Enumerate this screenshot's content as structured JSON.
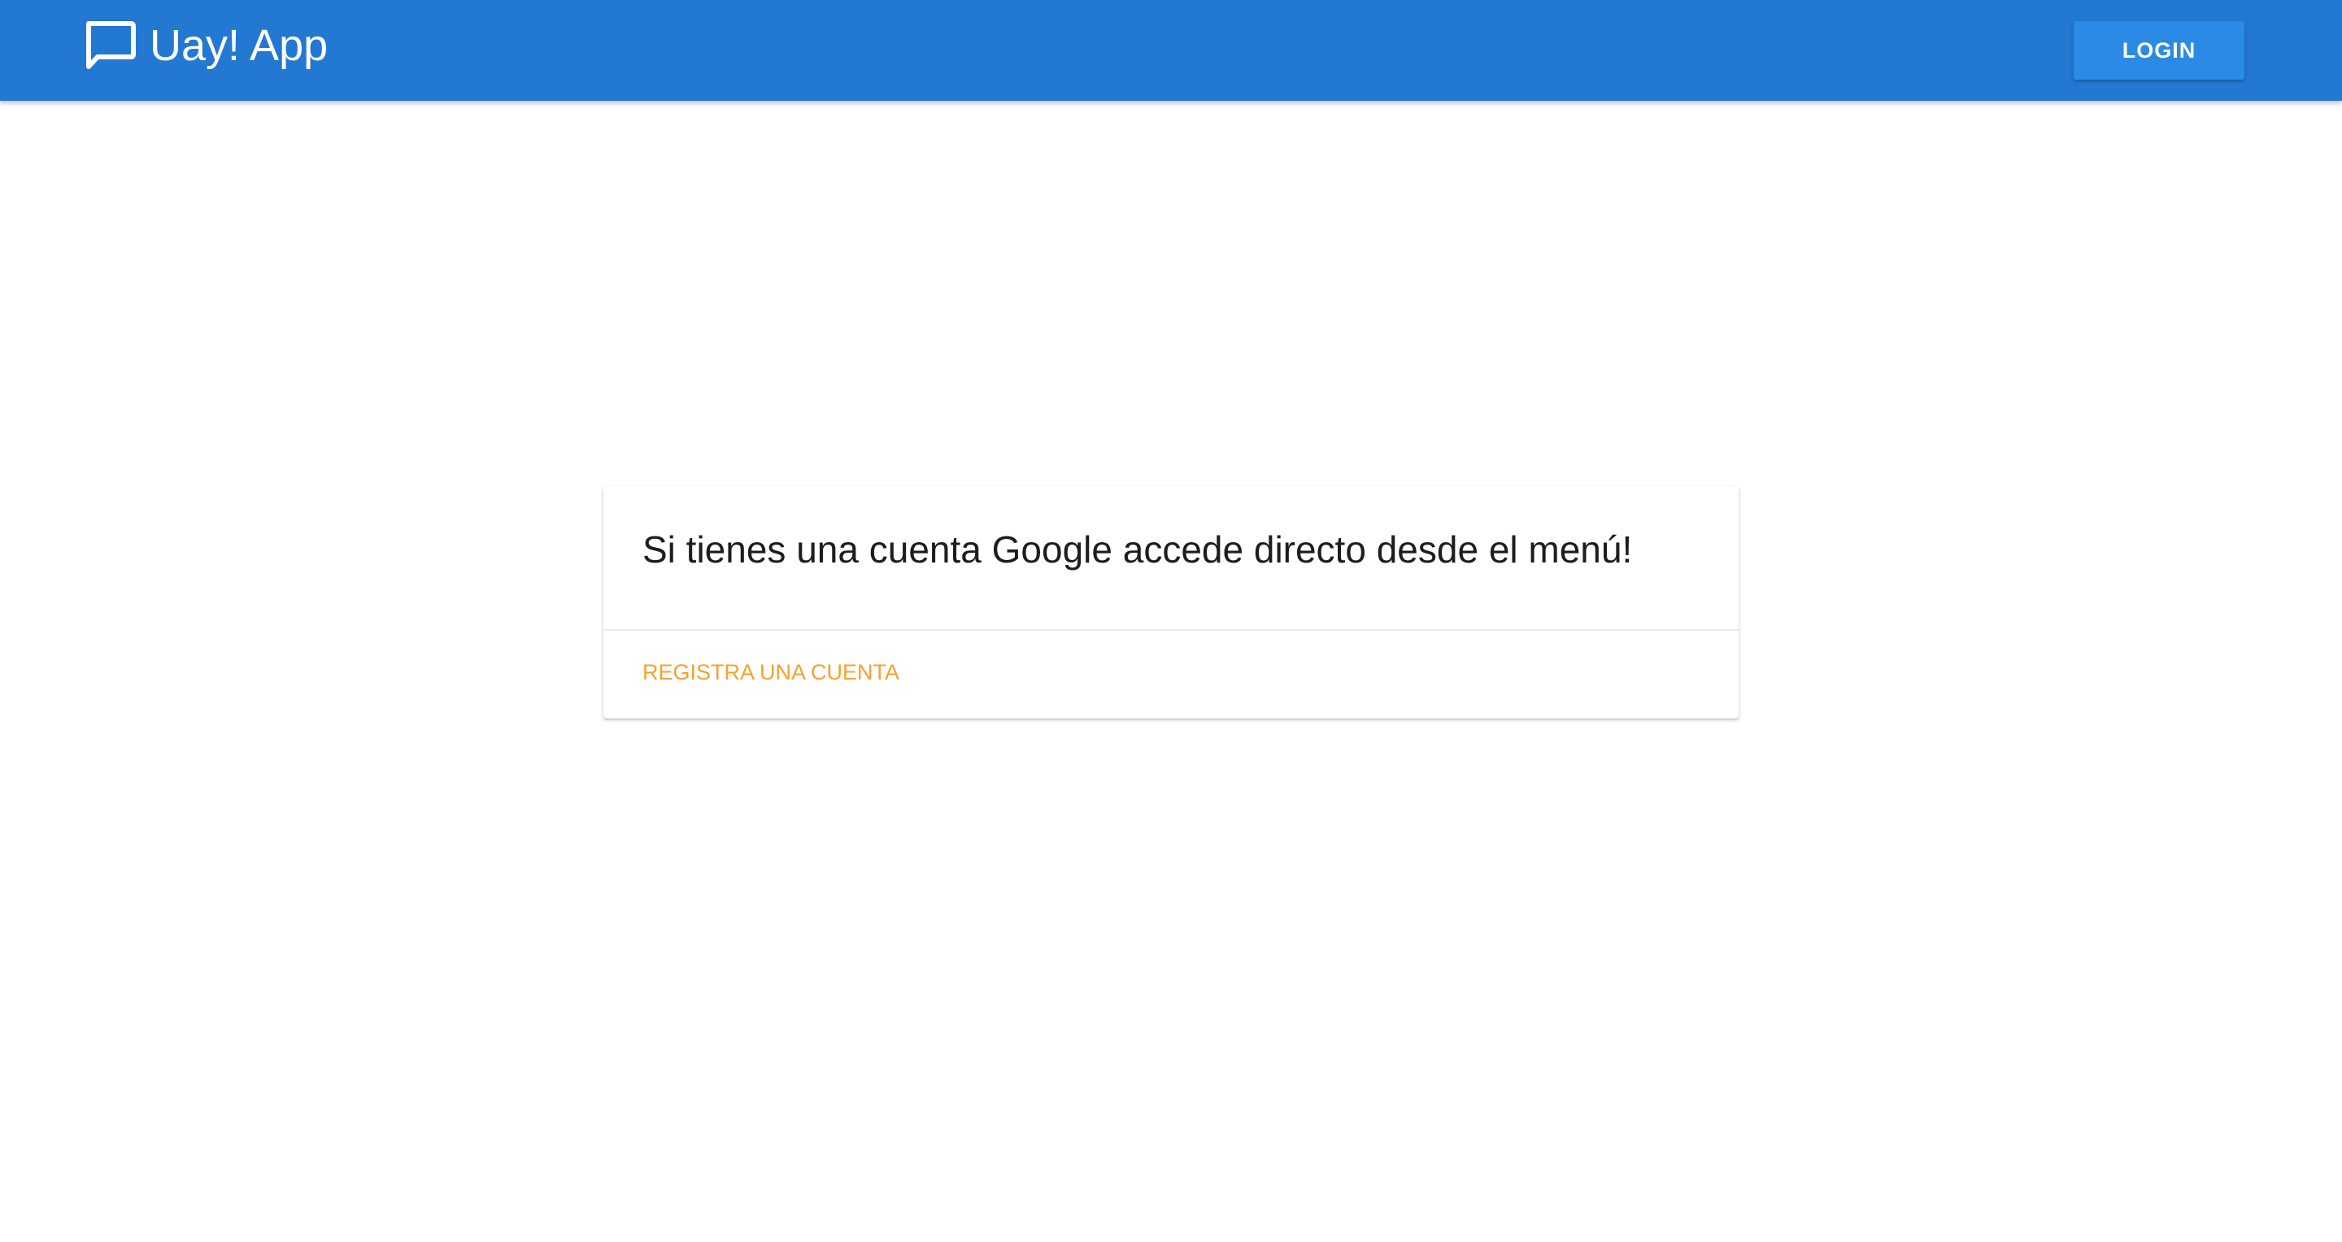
{
  "app_bar": {
    "title": "Uay! App",
    "icon": "chat-bubble-icon",
    "login_label": "LOGIN",
    "background_color": "#2378d2"
  },
  "card": {
    "message": "Si tienes una cuenta Google accede directo desde el menú!",
    "action_label": "REGISTRA UNA CUENTA",
    "action_color": "#f7a12e"
  }
}
